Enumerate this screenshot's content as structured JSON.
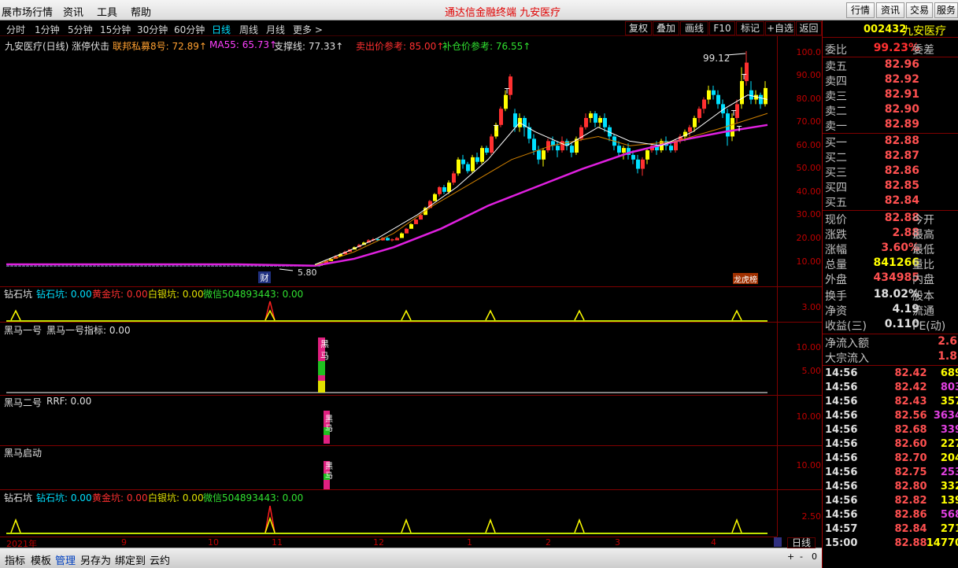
{
  "menu": {
    "items": [
      "展市场行情",
      "资讯",
      "工具",
      "帮助"
    ],
    "center": "通达信金融终端   九安医疗",
    "right": [
      "行情",
      "资讯",
      "交易",
      "服务"
    ]
  },
  "periods": [
    "分时",
    "1分钟",
    "5分钟",
    "15分钟",
    "30分钟",
    "60分钟",
    "日线",
    "周线",
    "月线",
    "更多 >"
  ],
  "tools": [
    "复权",
    "叠加",
    "画线",
    "F10",
    "标记",
    "+自选",
    "返回"
  ],
  "main": {
    "title": "九安医疗(日线) 涨停伏击",
    "lbl1": "联邦私募8号: 72.89↑",
    "lbl2": "MA55: 65.73↑",
    "lbl3": "支撑线: 77.33↑",
    "lbl4": "卖出价参考: 85.00↑",
    "lbl5": "补仓价参考: 76.55↑",
    "high": "99.12",
    "low": "5.80",
    "cai": "财",
    "bang": "龙虎榜",
    "t": "T",
    "axis": [
      "100.0",
      "90.00",
      "80.00",
      "70.00",
      "60.00",
      "50.00",
      "40.00",
      "30.00",
      "20.00",
      "10.00"
    ],
    "colors": {
      "up": "#ff3030",
      "down": "#00e0ff",
      "yellow": "#ffff00",
      "white": "#ffffff",
      "magenta": "#e020e0",
      "orange": "#d08000"
    }
  },
  "panel1": {
    "name": "钻石坑",
    "a": "钻石坑: 0.00",
    "b": "黄金坑: 0.00",
    "c": "白银坑: 0.00",
    "d": "微信504893443: 0.00",
    "axis": "3.00"
  },
  "panel2": {
    "name": "黑马一号",
    "a": "黑马一号指标: 0.00",
    "axis": [
      "10.00",
      "5.00"
    ],
    "chars": [
      "黑",
      "马",
      "一",
      "号"
    ]
  },
  "panel3": {
    "name": "黑马二号",
    "a": "RRF: 0.00",
    "axis": "10.00",
    "chars": [
      "黑",
      "马",
      "二",
      "号"
    ]
  },
  "panel4": {
    "name": "黑马启动",
    "axis": "10.00",
    "chars": [
      "黑",
      "马",
      "启",
      "动"
    ]
  },
  "panel5": {
    "name": "钻石坑",
    "a": "钻石坑: 0.00",
    "b": "黄金坑: 0.00",
    "c": "白银坑: 0.00",
    "d": "微信504893443: 0.00",
    "axis": "2.50"
  },
  "dates": [
    "2021年",
    "9",
    "10",
    "11",
    "12",
    "1",
    "2",
    "3",
    "4"
  ],
  "bottom": {
    "items": [
      "指标",
      "模板",
      "管理",
      "另存为",
      "绑定到",
      "云约"
    ],
    "right": "日线",
    "small": [
      "+",
      "-",
      "0"
    ]
  },
  "quote": {
    "code": "002432",
    "name": "九安医疗",
    "wb": "委比",
    "wbv": "99.23%",
    "wc": "委差",
    "sell": [
      [
        "卖五",
        "82.96"
      ],
      [
        "卖四",
        "82.92"
      ],
      [
        "卖三",
        "82.91"
      ],
      [
        "卖二",
        "82.90"
      ],
      [
        "卖一",
        "82.89"
      ]
    ],
    "buy": [
      [
        "买一",
        "82.88"
      ],
      [
        "买二",
        "82.87"
      ],
      [
        "买三",
        "82.86"
      ],
      [
        "买四",
        "82.85"
      ],
      [
        "买五",
        "82.84"
      ]
    ],
    "stats": [
      [
        "现价",
        "82.88",
        "今开"
      ],
      [
        "涨跌",
        "2.88",
        "最高"
      ],
      [
        "涨幅",
        "3.60%",
        "最低"
      ],
      [
        "总量",
        "841266",
        "量比"
      ],
      [
        "外盘",
        "434985",
        "内盘"
      ],
      [
        "换手",
        "18.02%",
        "股本"
      ],
      [
        "净资",
        "4.19",
        "流通"
      ],
      [
        "收益(三)",
        "0.110",
        "PE(动)"
      ]
    ],
    "flow": [
      [
        "净流入额",
        "2.6"
      ],
      [
        "大宗流入",
        "1.8"
      ]
    ],
    "ticks": [
      [
        "14:56",
        "82.42",
        "689"
      ],
      [
        "14:56",
        "82.42",
        "803"
      ],
      [
        "14:56",
        "82.43",
        "357"
      ],
      [
        "14:56",
        "82.56",
        "3634"
      ],
      [
        "14:56",
        "82.68",
        "339"
      ],
      [
        "14:56",
        "82.60",
        "227"
      ],
      [
        "14:56",
        "82.70",
        "204"
      ],
      [
        "14:56",
        "82.75",
        "253"
      ],
      [
        "14:56",
        "82.80",
        "332"
      ],
      [
        "14:56",
        "82.82",
        "139"
      ],
      [
        "14:56",
        "82.86",
        "568"
      ],
      [
        "14:57",
        "82.84",
        "271"
      ],
      [
        "15:00",
        "82.88",
        "14770"
      ]
    ]
  }
}
